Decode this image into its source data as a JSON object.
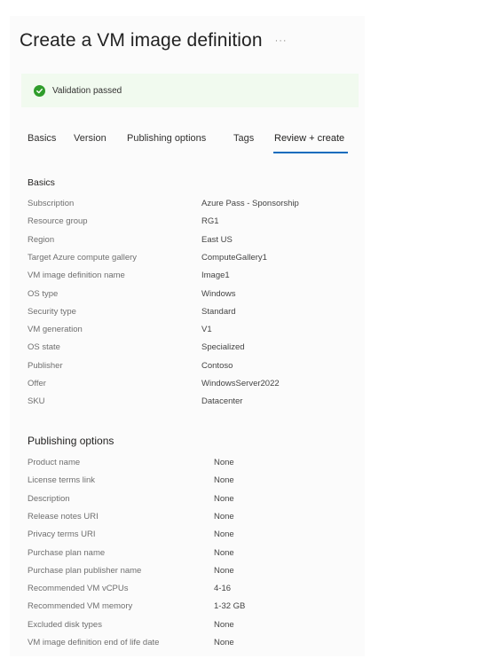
{
  "page": {
    "title": "Create a VM image definition",
    "more_label": "···"
  },
  "banner": {
    "status": "Validation passed",
    "icon": "check-circle-icon",
    "icon_color": "#2f9d2b"
  },
  "tabs": [
    {
      "label": "Basics",
      "active": false
    },
    {
      "label": "Version",
      "active": false
    },
    {
      "label": "Publishing options",
      "active": false
    },
    {
      "label": "Tags",
      "active": false
    },
    {
      "label": "Review + create",
      "active": true
    }
  ],
  "colors": {
    "accent": "#0f6cbd",
    "banner_bg": "#f1faef"
  },
  "basics": {
    "title": "Basics",
    "rows": [
      {
        "label": "Subscription",
        "value": "Azure Pass - Sponsorship"
      },
      {
        "label": "Resource group",
        "value": "RG1"
      },
      {
        "label": "Region",
        "value": "East US"
      },
      {
        "label": "Target Azure compute gallery",
        "value": "ComputeGallery1"
      },
      {
        "label": "VM image definition name",
        "value": "Image1"
      },
      {
        "label": "OS type",
        "value": "Windows"
      },
      {
        "label": "Security type",
        "value": "Standard"
      },
      {
        "label": "VM generation",
        "value": "V1"
      },
      {
        "label": "OS state",
        "value": "Specialized"
      },
      {
        "label": "Publisher",
        "value": "Contoso"
      },
      {
        "label": "Offer",
        "value": "WindowsServer2022"
      },
      {
        "label": "SKU",
        "value": "Datacenter"
      }
    ]
  },
  "publishing": {
    "title": "Publishing options",
    "rows": [
      {
        "label": "Product name",
        "value": "None"
      },
      {
        "label": "License terms link",
        "value": "None"
      },
      {
        "label": "Description",
        "value": "None"
      },
      {
        "label": "Release notes URI",
        "value": "None"
      },
      {
        "label": "Privacy terms URI",
        "value": "None"
      },
      {
        "label": "Purchase plan name",
        "value": "None"
      },
      {
        "label": "Purchase plan publisher name",
        "value": "None"
      },
      {
        "label": "Recommended VM vCPUs",
        "value": "4-16"
      },
      {
        "label": "Recommended VM memory",
        "value": "1-32 GB"
      },
      {
        "label": "Excluded disk types",
        "value": "None"
      },
      {
        "label": "VM image definition end of life date",
        "value": "None"
      }
    ]
  }
}
